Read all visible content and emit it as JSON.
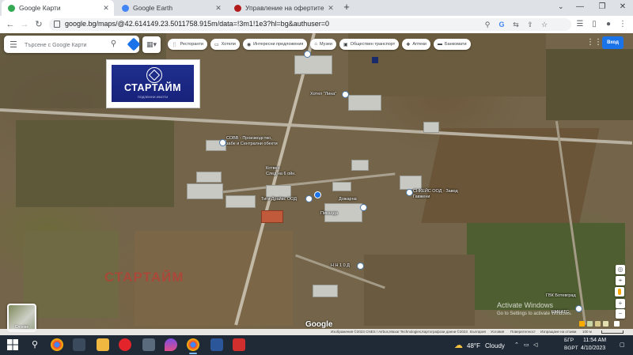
{
  "browser": {
    "tabs": [
      {
        "title": "Google Карти",
        "favicon": "google-maps-icon",
        "active": true
      },
      {
        "title": "Google Earth",
        "favicon": "google-earth-icon",
        "active": false
      },
      {
        "title": "Управление на офертите -",
        "favicon": "site-favicon-icon",
        "active": false
      }
    ],
    "new_tab_label": "+",
    "url": "google.bg/maps/@42.614149.23.5011758.915m/data=!3m1!1e3?hl=bg&authuser=0"
  },
  "maps": {
    "search_placeholder": "Търсене с Google Карти",
    "chips": [
      {
        "label": "Ресторанти",
        "icon": "fork-knife-icon"
      },
      {
        "label": "Хотели",
        "icon": "bed-icon"
      },
      {
        "label": "Интересни предложения",
        "icon": "camera-icon"
      },
      {
        "label": "Музеи",
        "icon": "museum-icon"
      },
      {
        "label": "Обществен транспорт",
        "icon": "bus-icon"
      },
      {
        "label": "Аптеки",
        "icon": "pharmacy-icon"
      },
      {
        "label": "Банкомати",
        "icon": "atm-icon"
      }
    ],
    "sign_in_label": "Вход",
    "logo": {
      "name": "СТАРТАЙМ",
      "tagline": "ПОДЗЕМНИ ИМОТИ"
    },
    "watermark": "СТАРТАЙМ",
    "layers_label": "Слоеве",
    "google_brand": "Google",
    "place_labels": [
      {
        "text": "Хотел \"Лина\""
      },
      {
        "text": "СОВВ - Производство,\nзабе и Сентрални обекти"
      },
      {
        "text": "Котвен\nСлед на 6 ойн."
      },
      {
        "text": "Тиги Драйвс ООД"
      },
      {
        "text": "Дожарна"
      },
      {
        "text": "Пиканда"
      },
      {
        "text": "Н Н 1 0 Д"
      },
      {
        "text": "СНКЕЙС ООД - Завод\nГавжени"
      },
      {
        "text": "ГВК Ботевград"
      },
      {
        "text": "ЕМКАТС"
      }
    ],
    "activate_windows": {
      "title": "Activate Windows",
      "subtitle": "Go to Settings to activate Windows."
    },
    "credits": [
      "Изображения ©2023 CNES / Airbus,Maxar Technologies,Картографски данни ©2023",
      "България",
      "Условия",
      "Поверителност",
      "Изпращане на отзиви",
      "100 м"
    ]
  },
  "taskbar": {
    "weather_temp": "48°F",
    "weather_desc": "Cloudy",
    "lang_top": "БГР",
    "lang_bottom": "BGPT",
    "time": "11:54 AM",
    "date": "4/10/2023"
  },
  "colors": {
    "accent": "#1a73e8",
    "taskbar": "#1f2a36",
    "logo_bg": "#1f2f8e",
    "watermark": "#d0312d"
  }
}
